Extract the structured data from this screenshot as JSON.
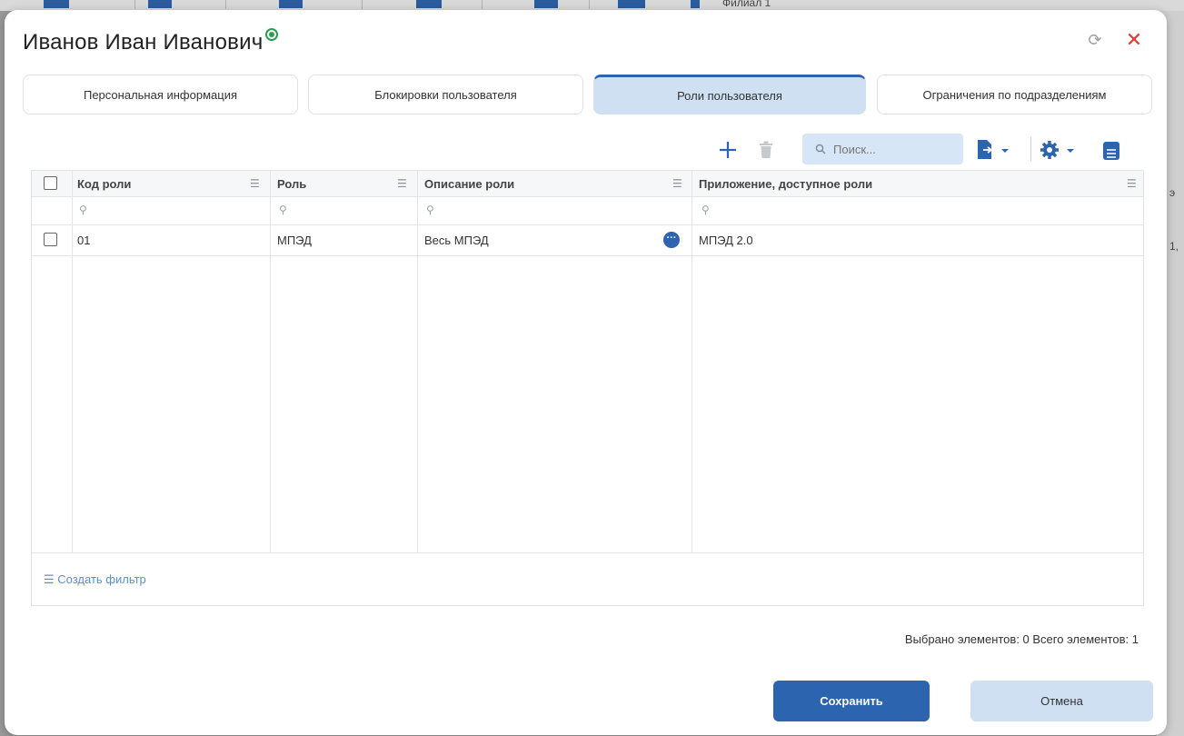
{
  "background": {
    "partial_text": "Филиал 1",
    "right_text_1": "э",
    "right_text_2": "1,"
  },
  "dialog": {
    "title": "Иванов Иван Иванович",
    "tabs": [
      {
        "label": "Персональная информация",
        "active": false
      },
      {
        "label": "Блокировки пользователя",
        "active": false
      },
      {
        "label": "Роли пользователя",
        "active": true
      },
      {
        "label": "Ограничения по подразделениям",
        "active": false
      }
    ],
    "toolbar": {
      "add_icon": "plus-icon",
      "delete_icon": "trash-icon",
      "search_placeholder": "Поиск...",
      "export_icon": "export-icon",
      "settings_icon": "gear-icon",
      "layout_icon": "table-layout-icon"
    },
    "grid": {
      "columns": [
        {
          "label": "Код роли"
        },
        {
          "label": "Роль"
        },
        {
          "label": "Описание роли"
        },
        {
          "label": "Приложение, доступное роли"
        }
      ],
      "rows": [
        {
          "code": "01",
          "role": "МПЭД",
          "description": "Весь МПЭД",
          "application": "МПЭД 2.0"
        }
      ],
      "create_filter_label": "Создать фильтр"
    },
    "status": {
      "text": "Выбрано элементов: 0  Всего элементов: 1"
    },
    "buttons": {
      "save": "Сохранить",
      "cancel": "Отмена"
    },
    "colors": {
      "accent": "#2c64b0",
      "active_tab": "#cfe0f3",
      "online": "#2e9d4e",
      "close": "#e53935"
    }
  }
}
